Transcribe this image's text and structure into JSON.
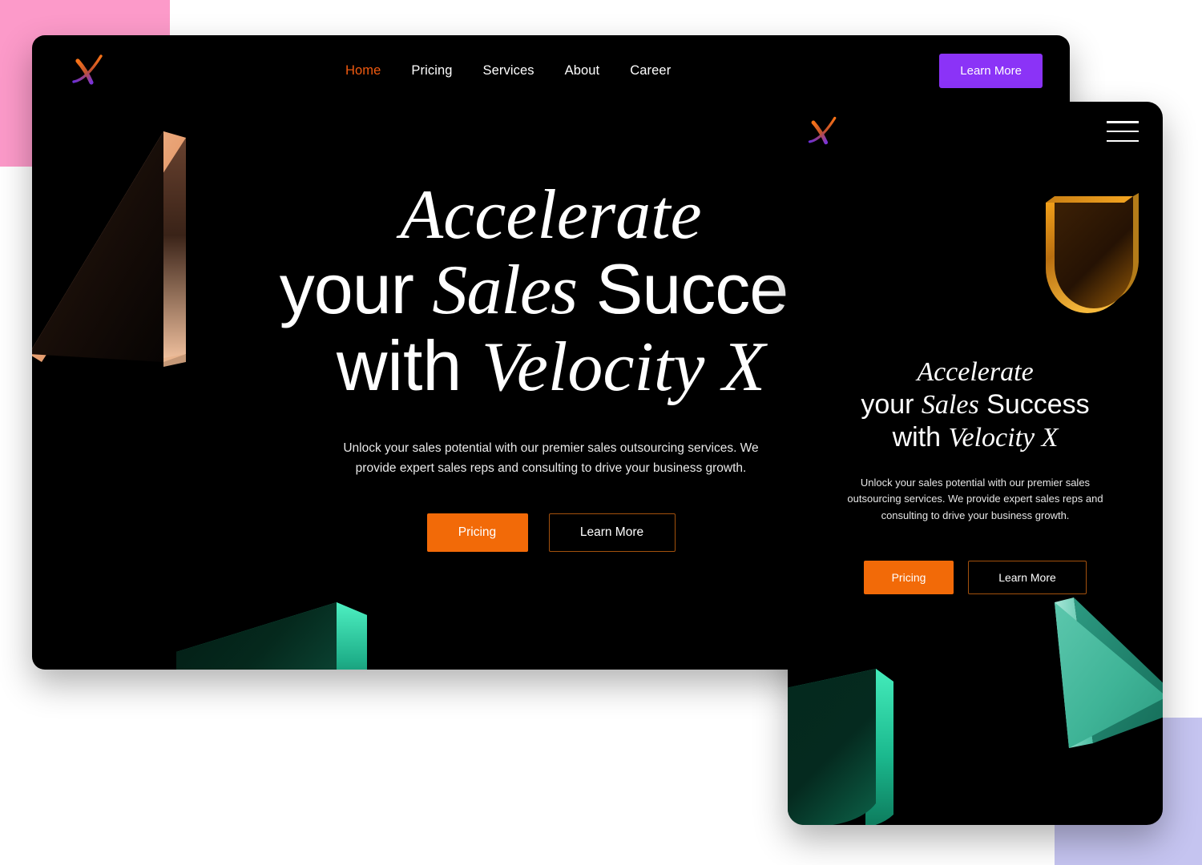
{
  "page": {
    "brand": "Velocity X",
    "logo_icon": "x-logo-icon"
  },
  "colors": {
    "accent_orange": "#f26a08",
    "accent_purple": "#8b33f7",
    "nav_active": "#f05a10",
    "outline_border": "#a3510d",
    "card_background": "#000000",
    "accent_square_pink": "#fc9ac9",
    "accent_square_purple": "#c5c4f0",
    "shape_copper": "#f0b288",
    "shape_green": "#1fb584",
    "shape_amber": "#f29a13"
  },
  "desktop": {
    "nav": {
      "links": [
        {
          "label": "Home",
          "active": true
        },
        {
          "label": "Pricing",
          "active": false
        },
        {
          "label": "Services",
          "active": false
        },
        {
          "label": "About",
          "active": false
        },
        {
          "label": "Career",
          "active": false
        }
      ],
      "cta_label": "Learn More"
    },
    "hero": {
      "line1_italic": "Accelerate",
      "line2_part1": "your ",
      "line2_italic": "Sales",
      "line2_part2": " Succes",
      "line3_part1": "with ",
      "line3_italic": "Velocity X",
      "subtitle": "Unlock your sales potential with our premier sales outsourcing services. We provide expert sales reps and consulting to drive your business growth.",
      "primary_cta": "Pricing",
      "secondary_cta": "Learn More"
    }
  },
  "mobile": {
    "nav": {
      "menu_icon": "hamburger-menu-icon"
    },
    "hero": {
      "line1_italic": "Accelerate",
      "line2_part1": "your ",
      "line2_italic": "Sales",
      "line2_part2": " Success",
      "line3_part1": "with ",
      "line3_italic": "Velocity X",
      "subtitle": "Unlock your sales potential with our premier sales outsourcing services. We provide expert sales reps and consulting to drive your business growth.",
      "primary_cta": "Pricing",
      "secondary_cta": "Learn More"
    }
  },
  "decor": {
    "desktop_shapes": [
      {
        "name": "copper-triangle-shape"
      },
      {
        "name": "green-slab-shape"
      }
    ],
    "mobile_shapes": [
      {
        "name": "amber-arch-shape"
      },
      {
        "name": "green-arch-shape"
      },
      {
        "name": "green-triangle-shape"
      }
    ]
  }
}
